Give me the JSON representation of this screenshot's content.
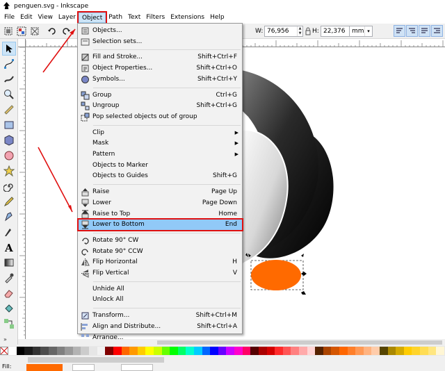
{
  "window": {
    "title": "penguen.svg - Inkscape"
  },
  "menubar": {
    "items": [
      "File",
      "Edit",
      "View",
      "Layer",
      "Object",
      "Path",
      "Text",
      "Filters",
      "Extensions",
      "Help"
    ],
    "active": "Object"
  },
  "toolbar": {
    "w_label": "W:",
    "w_value": "76,956",
    "h_label": "H:",
    "h_value": "22,376",
    "unit": "mm"
  },
  "object_menu": {
    "items": [
      {
        "label": "Objects...",
        "shortcut": "",
        "icon": "objects-icon"
      },
      {
        "label": "Selection sets...",
        "shortcut": "",
        "icon": "selection-sets-icon"
      },
      {
        "sep": true
      },
      {
        "label": "Fill and Stroke...",
        "shortcut": "Shift+Ctrl+F",
        "icon": "fill-stroke-icon"
      },
      {
        "label": "Object Properties...",
        "shortcut": "Shift+Ctrl+O",
        "icon": "object-properties-icon"
      },
      {
        "label": "Symbols...",
        "shortcut": "Shift+Ctrl+Y",
        "icon": "symbols-icon"
      },
      {
        "sep": true
      },
      {
        "label": "Group",
        "shortcut": "Ctrl+G",
        "icon": "group-icon"
      },
      {
        "label": "Ungroup",
        "shortcut": "Shift+Ctrl+G",
        "icon": "ungroup-icon"
      },
      {
        "label": "Pop selected objects out of group",
        "shortcut": "",
        "icon": "pop-out-icon"
      },
      {
        "sep": true
      },
      {
        "label": "Clip",
        "shortcut": "",
        "submenu": true
      },
      {
        "label": "Mask",
        "shortcut": "",
        "submenu": true
      },
      {
        "label": "Pattern",
        "shortcut": "",
        "submenu": true
      },
      {
        "label": "Objects to Marker",
        "shortcut": ""
      },
      {
        "label": "Objects to Guides",
        "shortcut": "Shift+G"
      },
      {
        "sep": true
      },
      {
        "label": "Raise",
        "shortcut": "Page Up",
        "icon": "raise-icon"
      },
      {
        "label": "Lower",
        "shortcut": "Page Down",
        "icon": "lower-icon"
      },
      {
        "label": "Raise to Top",
        "shortcut": "Home",
        "icon": "raise-to-top-icon"
      },
      {
        "label": "Lower to Bottom",
        "shortcut": "End",
        "icon": "lower-to-bottom-icon",
        "highlight": true
      },
      {
        "sep": true
      },
      {
        "label": "Rotate 90° CW",
        "shortcut": "",
        "icon": "rotate-cw-icon"
      },
      {
        "label": "Rotate 90° CCW",
        "shortcut": "",
        "icon": "rotate-ccw-icon"
      },
      {
        "label": "Flip Horizontal",
        "shortcut": "H",
        "icon": "flip-horizontal-icon"
      },
      {
        "label": "Flip Vertical",
        "shortcut": "V",
        "icon": "flip-vertical-icon"
      },
      {
        "sep": true
      },
      {
        "label": "Unhide All",
        "shortcut": ""
      },
      {
        "label": "Unlock All",
        "shortcut": ""
      },
      {
        "sep": true
      },
      {
        "label": "Transform...",
        "shortcut": "Shift+Ctrl+M",
        "icon": "transform-icon"
      },
      {
        "label": "Align and Distribute...",
        "shortcut": "Shift+Ctrl+A",
        "icon": "align-distribute-icon"
      },
      {
        "label": "Arrange...",
        "shortcut": "",
        "icon": "arrange-icon"
      }
    ]
  },
  "status": {
    "fill_label": "Fill:"
  },
  "palette": [
    "#ffffff",
    "#000000",
    "#1a1a1a",
    "#333333",
    "#4d4d4d",
    "#666666",
    "#808080",
    "#999999",
    "#b3b3b3",
    "#cccccc",
    "#e6e6e6",
    "#f2f2f2",
    "#800000",
    "#ff0000",
    "#ff6600",
    "#ff9900",
    "#ffcc00",
    "#ffff00",
    "#ccff00",
    "#66ff00",
    "#00ff00",
    "#00ff66",
    "#00ffcc",
    "#00ccff",
    "#0066ff",
    "#0000ff",
    "#6600ff",
    "#cc00ff",
    "#ff00cc",
    "#ff0066",
    "#550000",
    "#aa0000",
    "#d40000",
    "#ff2a2a",
    "#ff5555",
    "#ff8080",
    "#ffaaaa",
    "#ffd5d5",
    "#552200",
    "#aa4400",
    "#d45500",
    "#ff6600",
    "#ff7f2a",
    "#ff9955",
    "#ffb380",
    "#ffccaa",
    "#554400",
    "#aa8800",
    "#d4aa00",
    "#ffcc00",
    "#ffd42a",
    "#ffdd55",
    "#ffe680",
    "#fff6d5"
  ],
  "accent": "#ff6a00",
  "annotation_color": "#e01010"
}
